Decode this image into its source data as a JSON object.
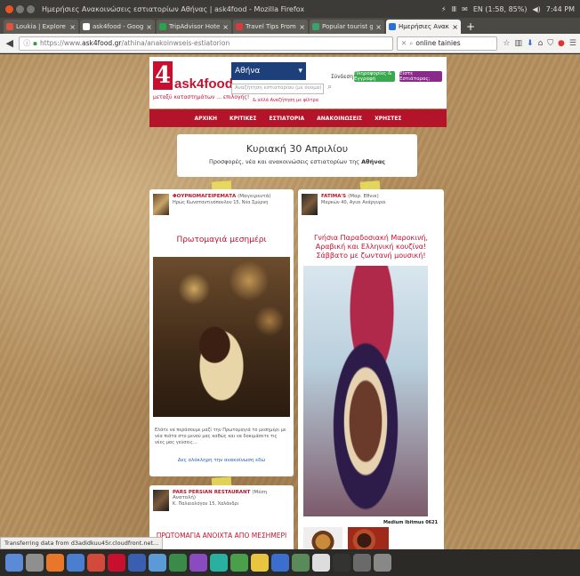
{
  "window": {
    "title": "Ημερήσιες Ανακοινώσεις εστιατορίων Αθήνας | ask4food - Mozilla Firefox",
    "tray": [
      "⚡",
      "Ⅲ",
      "✉",
      "EN (1:58, 85%)",
      "◀)",
      "7:44 PM"
    ]
  },
  "tabs": [
    {
      "label": "Loukia | Explore At...",
      "color": "#e0533c",
      "active": false
    },
    {
      "label": "ask4food - Google S...",
      "color": "#ffffff",
      "active": false
    },
    {
      "label": "TripAdvisor Hotels ...",
      "color": "#2aa34a",
      "active": false
    },
    {
      "label": "Travel Tips From Re...",
      "color": "#d93a3a",
      "active": false
    },
    {
      "label": "Popular tourist gui...",
      "color": "#3aa36a",
      "active": false
    },
    {
      "label": "Ημερήσιες Ανακοιν...",
      "color": "#2a6fd6",
      "active": true
    }
  ],
  "nav": {
    "url_prefix": "https://www.",
    "url_host": "ask4food.gr",
    "url_path": "/athina/anakoinwseis-estiatorion",
    "search_value": "online tainies",
    "icons": {
      "back": "◀",
      "info": "ⓘ",
      "lock": "🔒",
      "clear": "✕",
      "search": "🔍",
      "star": "☆",
      "home": "⌂",
      "download": "⬇",
      "shield": "▼",
      "menu": "☰"
    }
  },
  "site": {
    "logo_mark": "4",
    "logo_text": "ask4food",
    "tagline": "μεταξύ καταστημάτων ... επιλογής!",
    "city": "Αθήνα",
    "search_placeholder": "Αναζήτηση εστιατορίου (με όνομα)",
    "adv_search": "& αλλά Αναζήτηση με φίλτρα",
    "login": "Σύνδεση",
    "register_btn": "Πληροφορίες & Εγγραφή",
    "owner_btn": "Είστε Εστιάτορας;",
    "menu": [
      "ΑΡΧΙΚΗ",
      "ΚΡΙΤΙΚΕΣ",
      "ΕΣΤΙΑΤΟΡΙΑ",
      "ΑΝΑΚΟΙΝΩΣΕΙΣ",
      "ΧΡΗΣΤΕΣ"
    ]
  },
  "date_box": {
    "title": "Κυριακή 30 Απριλίου",
    "subtitle_pre": "Προσφορές, νέα και ανακοινώσεις εστιατορίων της",
    "subtitle_city": "Αθήνας"
  },
  "cards": [
    {
      "name": "ΦΟΥΡΝΟΜΑΓΕΙΡΕΜΑΤΑ",
      "type": "(Μαγειρευτά)",
      "address": "Ηρώς Κωνσταντινόπουλου 15, Νέα Σμύρνη",
      "title": "Πρωτομαγιά μεσημέρι",
      "body": "Ελάτε να περάσουμε μαζί την Πρωτομαγιά το μεσημέρι με νέα πιάτα στο μενού μας καθώς και να δοκιμάσετε τις νέες μας γεύσεις...",
      "link": "Δες ολόκληρη την ανακοίνωση εδώ"
    },
    {
      "name": "FATIMA'S",
      "type": "(Μαρ. Εθνικ)",
      "address": "Μαρκών 40, Αγιοι Ανάργυροι",
      "title": "Γνήσια Παραδοσιακή Μαροκινή, Αραβική και Ελληνική κουζίνα! Σάββατο με ζωντανή μουσική!",
      "badge": "Medium Ibitmus 0621"
    },
    {
      "name": "PARS PERSIAN RESTAURANT",
      "type": "(Μέση Ανατολή)",
      "address": "Κ. Παλαιολόγου 15, Χαλάνδρι",
      "title": "ΠΡΩΤΟΜΑΓΙΑ ΑΝΟΙΧΤΑ ΑΠΟ ΜΕΣΗΜΕΡΙ"
    }
  ],
  "status": "Transferring data from d3adidkuu45r.cloudfront.net...",
  "launcher_colors": [
    "#5b8bd6",
    "#8f8f8f",
    "#e8772a",
    "#4a7fd0",
    "#d24a3a",
    "#c8102e",
    "#3a5fb0",
    "#5a9ad6",
    "#3a8a4a",
    "#8a4ac0",
    "#2ab0a0",
    "#4aa04a",
    "#e8c440",
    "#3a6fd0",
    "#5a8a5a",
    "#ddd",
    "#333",
    "#6a6a6a",
    "#888"
  ]
}
